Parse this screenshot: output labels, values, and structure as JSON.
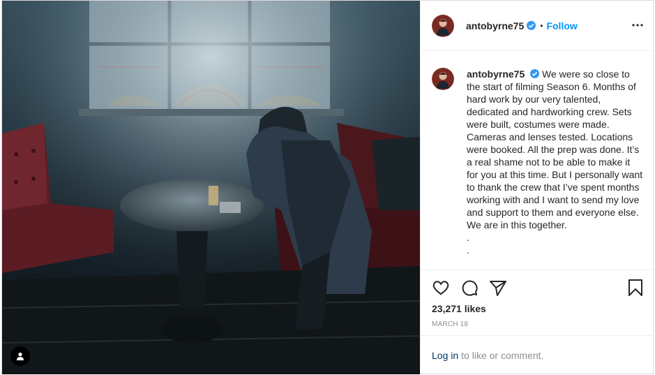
{
  "post": {
    "username": "antobyrne75",
    "follow_label": "Follow",
    "separator": "•",
    "caption": "We were so close to the start of filming Season 6. Months of hard work by our very talented, dedicated and hardworking crew. Sets were built, costumes were made. Cameras and lenses tested. Locations were booked. All the prep was done. It’s a real shame not to be able to make it for you at this time. But I personally want to thank the crew that I’ve spent months working with and I want to send my love and support to them and everyone else. We are in this together.",
    "caption_tail": [
      ".",
      "."
    ],
    "likes": "23,271 likes",
    "date": "MARCH 18",
    "login_label": "Log in",
    "comment_prompt": "to like or comment."
  },
  "icons": {
    "verified": "verified-badge-icon",
    "more": "more-options-icon",
    "like": "heart-icon",
    "comment": "comment-icon",
    "share": "paper-plane-icon",
    "save": "bookmark-icon",
    "user_tag": "user-tag-icon"
  },
  "colors": {
    "follow": "#0095f6",
    "verified": "#3897f0",
    "login": "#00376b",
    "muted": "#8e8e8e",
    "text": "#262626"
  }
}
